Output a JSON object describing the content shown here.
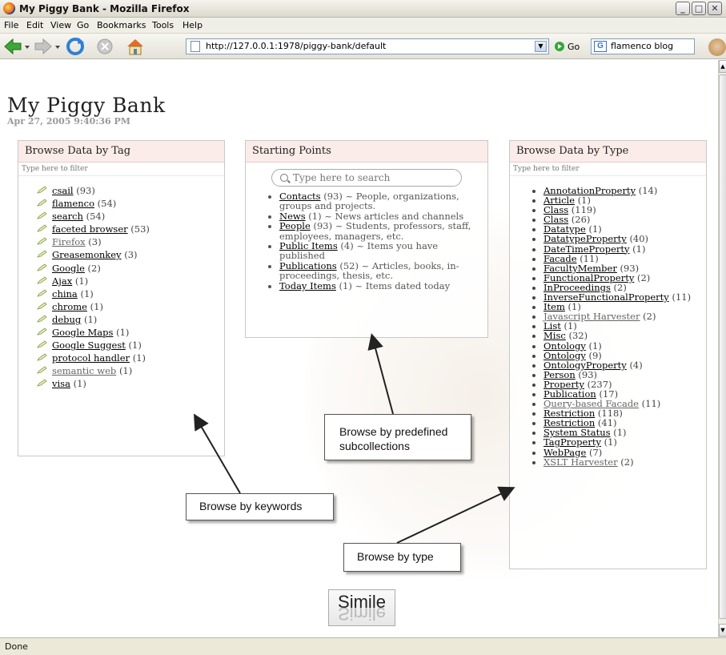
{
  "window": {
    "title": "My Piggy Bank - Mozilla Firefox",
    "buttons": [
      "minimize",
      "maximize",
      "close"
    ]
  },
  "menubar": {
    "items": [
      "File",
      "Edit",
      "View",
      "Go",
      "Bookmarks",
      "Tools",
      "Help"
    ]
  },
  "navbar": {
    "url": "http://127.0.0.1:1978/piggy-bank/default",
    "go_label": "Go",
    "search_value": "flamenco blog"
  },
  "page": {
    "title": "My Piggy Bank",
    "date": "Apr 27, 2005 9:40:36 PM"
  },
  "tag_panel": {
    "header": "Browse Data by Tag",
    "filter_placeholder": "Type here to filter",
    "items": [
      {
        "label": "csail",
        "count": "(93)"
      },
      {
        "label": "flamenco",
        "count": "(54)"
      },
      {
        "label": "search",
        "count": "(54)"
      },
      {
        "label": "faceted browser",
        "count": "(53)"
      },
      {
        "label": "Firefox",
        "count": "(3)"
      },
      {
        "label": "Greasemonkey",
        "count": "(3)"
      },
      {
        "label": "Google",
        "count": "(2)"
      },
      {
        "label": "Ajax",
        "count": "(1)"
      },
      {
        "label": "china",
        "count": "(1)"
      },
      {
        "label": "chrome",
        "count": "(1)"
      },
      {
        "label": "debug",
        "count": "(1)"
      },
      {
        "label": "Google Maps",
        "count": "(1)"
      },
      {
        "label": "Google Suggest",
        "count": "(1)"
      },
      {
        "label": "protocol handler",
        "count": "(1)"
      },
      {
        "label": "semantic web",
        "count": "(1)"
      },
      {
        "label": "visa",
        "count": "(1)"
      }
    ]
  },
  "starting_points": {
    "header": "Starting Points",
    "search_placeholder": "Type here to search",
    "items": [
      {
        "label": "Contacts",
        "count": "(93)",
        "desc": " ~ People, organizations, groups and projects."
      },
      {
        "label": "News",
        "count": "(1)",
        "desc": " ~ News articles and channels"
      },
      {
        "label": "People",
        "count": "(93)",
        "desc": " ~ Students, professors, staff, employees, managers, etc."
      },
      {
        "label": "Public Items",
        "count": "(4)",
        "desc": " ~ Items you have published"
      },
      {
        "label": "Publications",
        "count": "(52)",
        "desc": " ~ Articles, books, in-proceedings, thesis, etc."
      },
      {
        "label": "Today Items",
        "count": "(1)",
        "desc": " ~ Items dated today"
      }
    ]
  },
  "type_panel": {
    "header": "Browse Data by Type",
    "filter_placeholder": "Type here to filter",
    "items": [
      {
        "label": "AnnotationProperty",
        "count": "(14)"
      },
      {
        "label": "Article",
        "count": "(1)"
      },
      {
        "label": "Class",
        "count": "(119)"
      },
      {
        "label": "Class",
        "count": "(26)"
      },
      {
        "label": "Datatype",
        "count": "(1)"
      },
      {
        "label": "DatatypeProperty",
        "count": "(40)"
      },
      {
        "label": "DateTimeProperty",
        "count": "(1)"
      },
      {
        "label": "Facade",
        "count": "(11)"
      },
      {
        "label": "FacultyMember",
        "count": "(93)"
      },
      {
        "label": "FunctionalProperty",
        "count": "(2)"
      },
      {
        "label": "InProceedings",
        "count": "(2)"
      },
      {
        "label": "InverseFunctionalProperty",
        "count": "(11)"
      },
      {
        "label": "Item",
        "count": "(1)"
      },
      {
        "label": "Javascript Harvester",
        "count": "(2)"
      },
      {
        "label": "List",
        "count": "(1)"
      },
      {
        "label": "Misc",
        "count": "(32)"
      },
      {
        "label": "Ontology",
        "count": "(1)"
      },
      {
        "label": "Ontology",
        "count": "(9)"
      },
      {
        "label": "OntologyProperty",
        "count": "(4)"
      },
      {
        "label": "Person",
        "count": "(93)"
      },
      {
        "label": "Property",
        "count": "(237)"
      },
      {
        "label": "Publication",
        "count": "(17)"
      },
      {
        "label": "Query-based Facade",
        "count": "(11)"
      },
      {
        "label": "Restriction",
        "count": "(118)"
      },
      {
        "label": "Restriction",
        "count": "(41)"
      },
      {
        "label": "System Status",
        "count": "(1)"
      },
      {
        "label": "TagProperty",
        "count": "(1)"
      },
      {
        "label": "WebPage",
        "count": "(7)"
      },
      {
        "label": "XSLT Harvester",
        "count": "(2)"
      }
    ]
  },
  "callouts": {
    "keywords": "Browse by keywords",
    "subcollections": "Browse by predefined subcollections",
    "type": "Browse by type"
  },
  "logo_text": "Simile",
  "status": "Done",
  "colors": {
    "panel_header_bg": "#fbece9",
    "link": "#000000",
    "grey_link": "#666666"
  }
}
